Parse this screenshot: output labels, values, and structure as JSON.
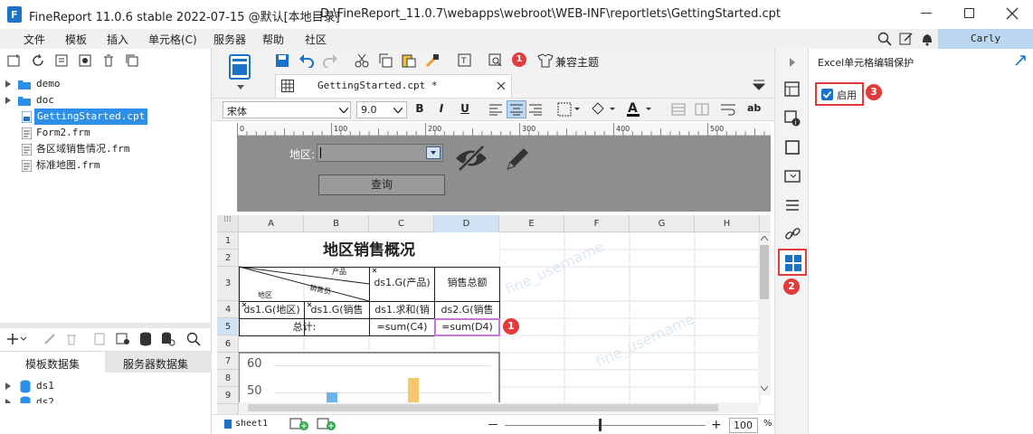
{
  "window": {
    "title": "FineReport 11.0.6 stable 2022-07-15 @默认[本地目录]",
    "path": "D:\\FineReport_11.0.7\\webapps\\webroot\\WEB-INF\\reportlets\\GettingStarted.cpt"
  },
  "menu": [
    "文件",
    "模板",
    "插入",
    "单元格(C)",
    "服务器",
    "帮助",
    "社区"
  ],
  "user": "Carly",
  "tree": [
    {
      "label": "demo",
      "type": "folder"
    },
    {
      "label": "doc",
      "type": "folder"
    },
    {
      "label": "GettingStarted.cpt",
      "type": "cpt",
      "selected": true
    },
    {
      "label": "Form2.frm",
      "type": "frm"
    },
    {
      "label": "各区域销售情况.frm",
      "type": "frm"
    },
    {
      "label": "标准地图.frm",
      "type": "frm"
    }
  ],
  "dataset_tabs": [
    "模板数据集",
    "服务器数据集"
  ],
  "datasets": [
    "ds1",
    "ds2"
  ],
  "toolbar": {
    "theme_label": "兼容主题",
    "badge_count": "1"
  },
  "doc_tab": "GettingStarted.cpt *",
  "format": {
    "font": "宋体",
    "size": "9.0"
  },
  "ruler": [
    "0",
    "100",
    "200",
    "300",
    "400",
    "500"
  ],
  "param": {
    "label": "地区:",
    "query_button": "查询"
  },
  "columns": [
    "A",
    "B",
    "C",
    "D",
    "E",
    "F",
    "G",
    "H"
  ],
  "rows": [
    "1",
    "2",
    "3",
    "4",
    "5",
    "6",
    "7",
    "8",
    "9"
  ],
  "cells": {
    "title": "地区销售概况",
    "diag_product": "产品",
    "diag_salesman": "销售员",
    "diag_region": "地区",
    "c3": "ds1.G(产品)",
    "d3": "销售总额",
    "a4": "ds1.G(地区)",
    "b4": "ds1.G(销售",
    "c4": "ds1.求和(销",
    "d4": "ds2.G(销售",
    "a5": "总计:",
    "c5": "=sum(C4)",
    "d5": "=sum(D4)"
  },
  "embedded_chart": {
    "y_ticks": [
      "60",
      "50"
    ]
  },
  "watermark": "fine_username",
  "sheet_tab": "sheet1",
  "zoom": "100",
  "zoom_unit": "%",
  "right_panel": {
    "title": "Excel单元格编辑保护",
    "checkbox_label": "启用",
    "checked": true
  },
  "callouts": [
    "1",
    "2",
    "3"
  ],
  "colors": {
    "accent": "#1a73c9",
    "badge": "#e23b3b",
    "selection": "#c678d6"
  }
}
